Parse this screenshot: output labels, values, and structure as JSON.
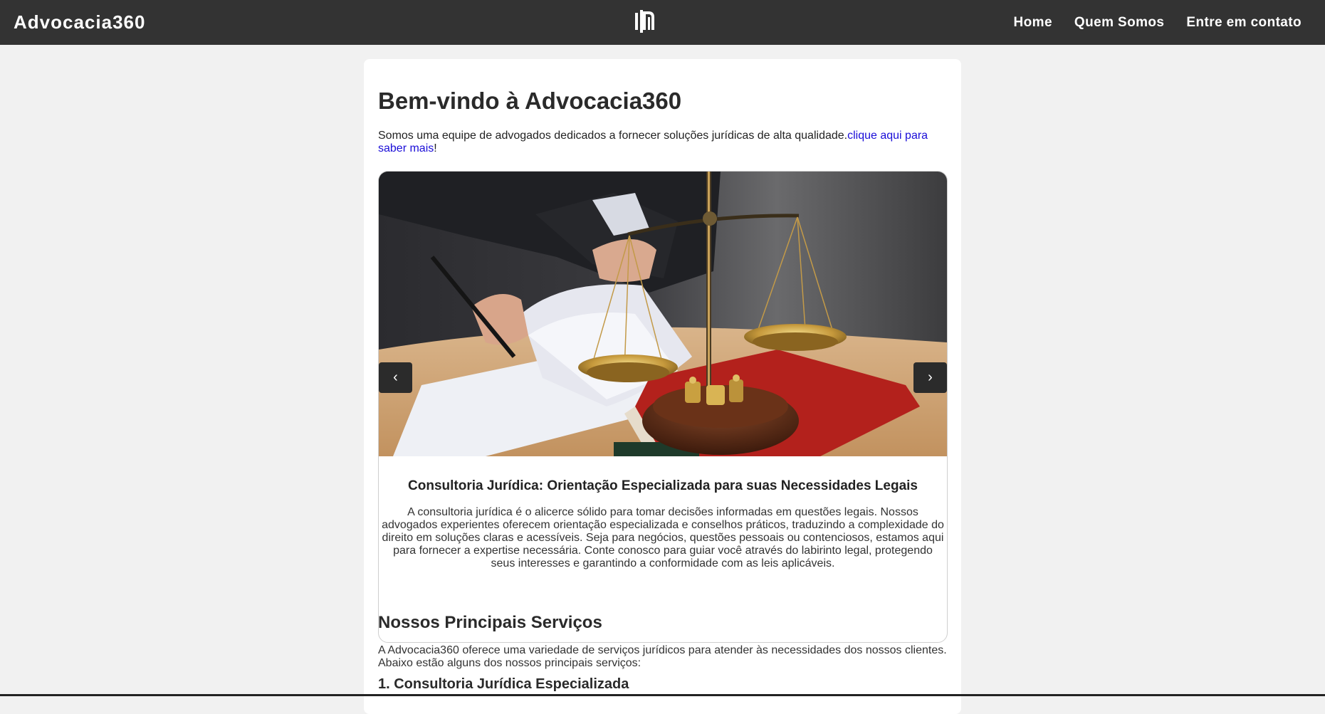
{
  "header": {
    "brand": "Advocacia360",
    "logo_icon": "law-firm-logo-icon",
    "nav": [
      {
        "label": "Home"
      },
      {
        "label": "Quem Somos"
      },
      {
        "label": "Entre em contato"
      }
    ]
  },
  "main": {
    "title": "Bem-vindo à Advocacia360",
    "intro_text": "Somos uma equipe de advogados dedicados a fornecer soluções jurídicas de alta qualidade.",
    "intro_link": "clique aqui para saber mais",
    "intro_suffix": "!"
  },
  "carousel": {
    "prev_label": "‹",
    "next_label": "›",
    "slide_title": "Consultoria Jurídica: Orientação Especializada para suas Necessidades Legais",
    "slide_text": "A consultoria jurídica é o alicerce sólido para tomar decisões informadas em questões legais. Nossos advogados experientes oferecem orientação especializada e conselhos práticos, traduzindo a complexidade do direito em soluções claras e acessíveis. Seja para negócios, questões pessoais ou contenciosos, estamos aqui para fornecer a expertise necessária. Conte conosco para guiar você através do labirinto legal, protegendo seus interesses e garantindo a conformidade com as leis aplicáveis."
  },
  "services": {
    "title": "Nossos Principais Serviços",
    "text": "A Advocacia360 oferece uma variedade de serviços jurídicos para atender às necessidades dos nossos clientes. Abaixo estão alguns dos nossos principais serviços:",
    "first_service": "1. Consultoria Jurídica Especializada"
  },
  "colors": {
    "topbar": "#333333",
    "page_bg": "#f1f1f1",
    "link": "#1a0dd8"
  }
}
